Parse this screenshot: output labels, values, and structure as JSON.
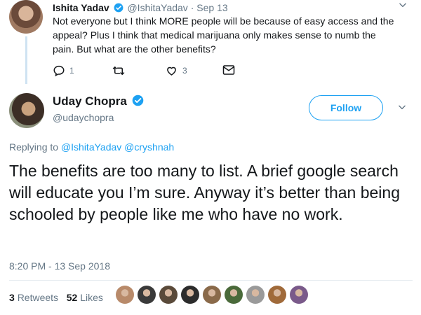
{
  "parent": {
    "name": "Ishita Yadav",
    "handle": "@IshitaYadav",
    "separator": "·",
    "date": "Sep 13",
    "text": "Not everyone but I think MORE people will be because of easy access and the appeal? Plus I think that medical marijuana only makes sense to numb the pain. But what are the other benefits?",
    "reply_count": "1",
    "retweet_count": "",
    "like_count": "3"
  },
  "tweet": {
    "name": "Uday Chopra",
    "handle": "@udaychopra",
    "follow_label": "Follow",
    "replying_prefix": "Replying to",
    "mentions": [
      "@IshitaYadav",
      "@cryshnah"
    ],
    "text": "The benefits are too many to list. A brief google search will educate you I’m sure. Anyway it’s better than being schooled by people like me who have no work.",
    "timestamp": "8:20 PM - 13 Sep 2018",
    "retweets_count": "3",
    "retweets_label": "Retweets",
    "likes_count": "52",
    "likes_label": "Likes"
  },
  "likers": [
    {
      "color": "#b88a6a"
    },
    {
      "color": "#3a3a3a"
    },
    {
      "color": "#5a4a3a"
    },
    {
      "color": "#2c2c2c"
    },
    {
      "color": "#8a6a4a"
    },
    {
      "color": "#4a6a3a"
    },
    {
      "color": "#9a9a9a"
    },
    {
      "color": "#a06a3a"
    },
    {
      "color": "#7a5a8a"
    }
  ],
  "colors": {
    "accent": "#1da1f2",
    "text": "#14171a",
    "muted": "#657786",
    "border": "#e6ecf0"
  }
}
